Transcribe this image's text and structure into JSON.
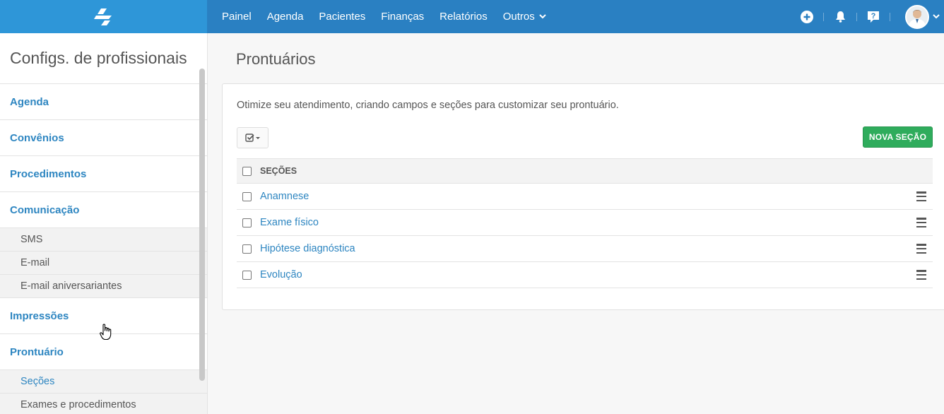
{
  "nav": {
    "items": [
      "Painel",
      "Agenda",
      "Pacientes",
      "Finanças",
      "Relatórios",
      "Outros"
    ]
  },
  "topbar": {
    "icons": [
      "add-circle-icon",
      "bell-icon",
      "help-icon",
      "avatar"
    ]
  },
  "sidebar": {
    "title": "Configs. de profissionais",
    "items": [
      {
        "label": "Agenda"
      },
      {
        "label": "Convênios"
      },
      {
        "label": "Procedimentos"
      },
      {
        "label": "Comunicação",
        "sub": [
          "SMS",
          "E-mail",
          "E-mail aniversariantes"
        ]
      },
      {
        "label": "Impressões"
      },
      {
        "label": "Prontuário",
        "sub": [
          "Seções",
          "Exames e procedimentos"
        ],
        "active_sub": "Seções"
      }
    ]
  },
  "main": {
    "title": "Prontuários",
    "description": "Otimize seu atendimento, criando campos e seções para customizar seu prontuário.",
    "new_button": "NOVA SEÇÃO",
    "table": {
      "header": "SEÇÕES",
      "rows": [
        "Anamnese",
        "Exame físico",
        "Hipótese diagnóstica",
        "Evolução"
      ]
    }
  },
  "colors": {
    "topbar": "#2a80c2",
    "logo_bg": "#2e96d8",
    "link": "#2e86c1",
    "primary_action": "#2fac5c"
  }
}
